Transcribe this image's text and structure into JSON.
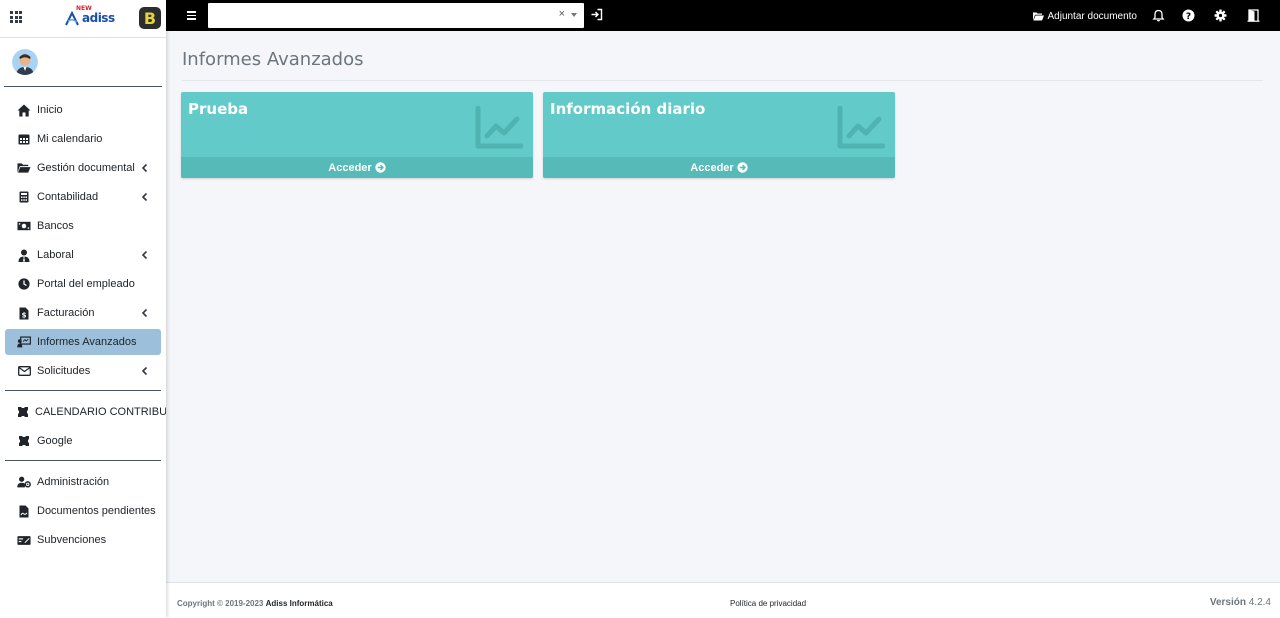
{
  "brand": {
    "logo_text": "adiss",
    "logo_sup": "NEW",
    "b_app_letter": "B"
  },
  "nav": {
    "items": [
      {
        "label": "Inicio",
        "icon": "home-icon"
      },
      {
        "label": "Mi calendario",
        "icon": "calendar-icon"
      },
      {
        "label": "Gestión documental",
        "icon": "folder-open-icon",
        "chevron": true
      },
      {
        "label": "Contabilidad",
        "icon": "calculator-icon",
        "chevron": true
      },
      {
        "label": "Bancos",
        "icon": "money-bill-icon"
      },
      {
        "label": "Laboral",
        "icon": "user-tie-icon",
        "chevron": true
      },
      {
        "label": "Portal del empleado",
        "icon": "clock-icon"
      },
      {
        "label": "Facturación",
        "icon": "file-invoice-icon",
        "chevron": true
      },
      {
        "label": "Informes Avanzados",
        "icon": "chalkboard-user-icon",
        "active": true
      },
      {
        "label": "Solicitudes",
        "icon": "envelope-icon",
        "chevron": true
      }
    ],
    "external": [
      {
        "label": "CALENDARIO CONTRIBUYENTE",
        "icon": "puzzle-icon"
      },
      {
        "label": "Google",
        "icon": "puzzle-icon"
      }
    ],
    "admin": [
      {
        "label": "Administración",
        "icon": "user-cog-icon"
      },
      {
        "label": "Documentos pendientes",
        "icon": "file-signature-icon"
      },
      {
        "label": "Subvenciones",
        "icon": "money-check-icon"
      }
    ]
  },
  "topbar": {
    "search_value": "",
    "clear_glyph": "×",
    "attach_label": "Adjuntar documento"
  },
  "page": {
    "title": "Informes Avanzados",
    "cards": [
      {
        "title": "Prueba",
        "action": "Acceder"
      },
      {
        "title": "Información diario",
        "action": "Acceder"
      }
    ]
  },
  "footer": {
    "copyright_prefix": "Copyright © 2019-2023",
    "company": "Adiss Informática",
    "privacy": "Política de privacidad",
    "version_label": "Versión",
    "version_number": "4.2.4"
  },
  "colors": {
    "card_bg": "#62cbc9",
    "card_footer_bg": "#55bab8",
    "active_nav_bg": "#9cc0db",
    "topbar_bg": "#000000"
  }
}
